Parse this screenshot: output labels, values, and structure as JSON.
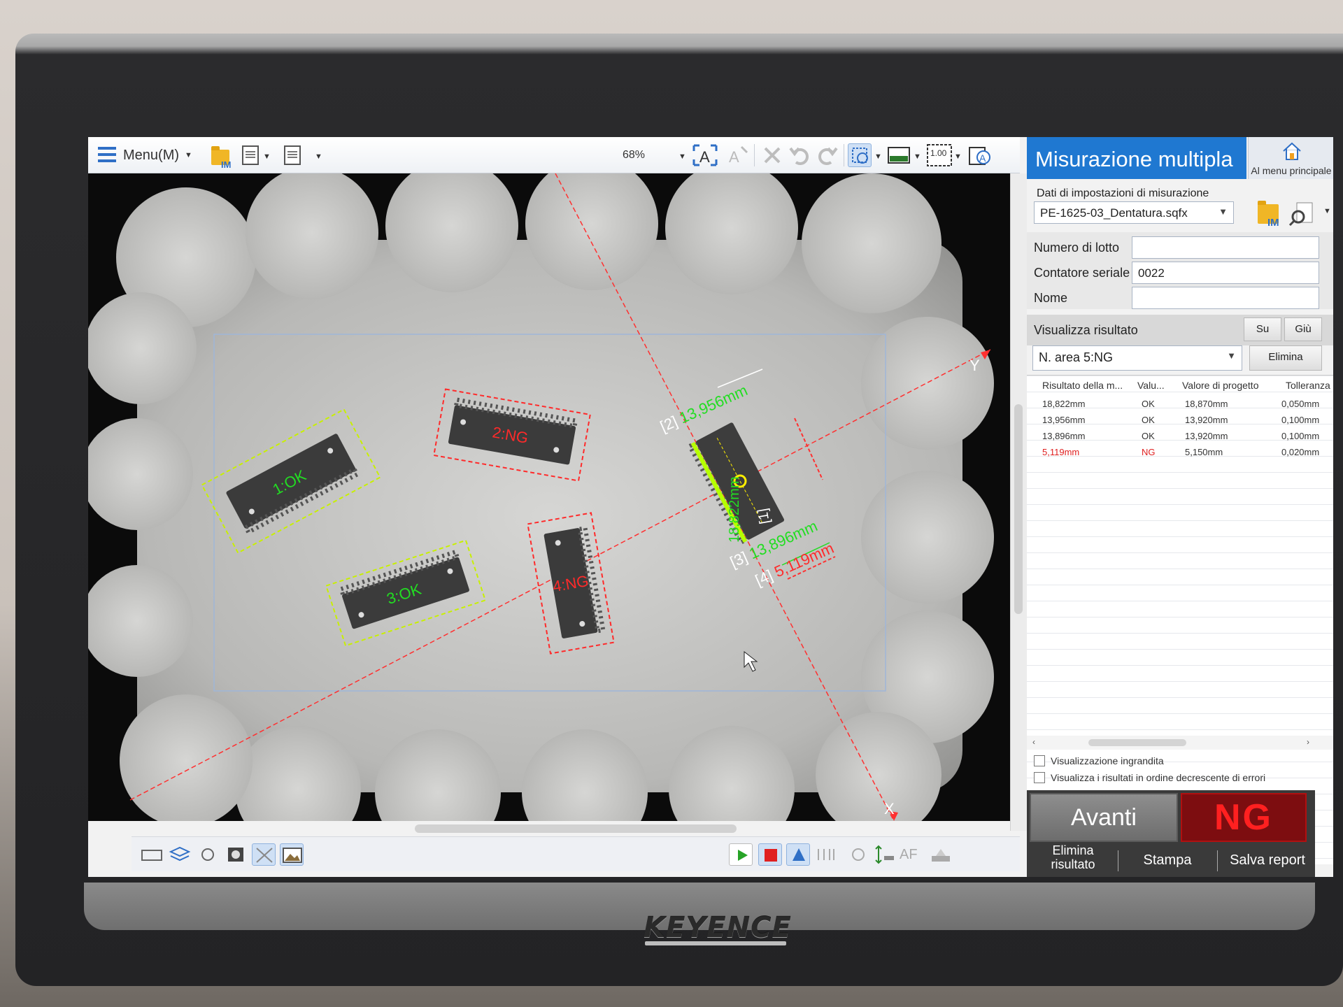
{
  "toolbar": {
    "menu_label": "Menu(M)",
    "zoom_label": "68%",
    "im_tag": "IM",
    "value_tag": "1.00"
  },
  "image": {
    "axis_x_label": "X",
    "axis_y_label": "Y",
    "areas": [
      {
        "label": "1:OK",
        "status": "OK"
      },
      {
        "label": "2:NG",
        "status": "NG"
      },
      {
        "label": "3:OK",
        "status": "OK"
      },
      {
        "label": "4:NG",
        "status": "NG"
      }
    ],
    "measurements": [
      {
        "tag": "[1]",
        "value": "18,822mm",
        "status": "OK"
      },
      {
        "tag": "[2]",
        "value": "13,956mm",
        "status": "OK"
      },
      {
        "tag": "[3]",
        "value": "13,896mm",
        "status": "OK"
      },
      {
        "tag": "[4]",
        "value": "5,119mm",
        "status": "NG"
      }
    ]
  },
  "panel": {
    "title": "Misurazione multipla",
    "home_label": "Al menu principale",
    "settings_label": "Dati di impostazioni di misurazione",
    "settings_file": "PE-1625-03_Dentatura.sqfx",
    "im_tag": "IM",
    "lot_label": "Numero di lotto",
    "lot_value": "",
    "serial_label": "Contatore seriale",
    "serial_value": "0022",
    "name_label": "Nome",
    "name_value": "",
    "result_section": "Visualizza risultato",
    "up_btn": "Su",
    "down_btn": "Giù",
    "area_select": "N. area 5:NG",
    "delete_btn": "Elimina",
    "table": {
      "headers": [
        "Risultato della m...",
        "Valu...",
        "Valore di progetto",
        "Tolleranza"
      ],
      "rows": [
        {
          "result": "18,822mm",
          "judge": "OK",
          "design": "18,870mm",
          "tol": "0,050mm"
        },
        {
          "result": "13,956mm",
          "judge": "OK",
          "design": "13,920mm",
          "tol": "0,100mm"
        },
        {
          "result": "13,896mm",
          "judge": "OK",
          "design": "13,920mm",
          "tol": "0,100mm"
        },
        {
          "result": "5,119mm",
          "judge": "NG",
          "design": "5,150mm",
          "tol": "0,020mm"
        }
      ]
    },
    "check_enlarged": "Visualizzazione ingrandita",
    "check_errors_desc": "Visualizza i risultati in ordine decrescente di errori",
    "next_btn": "Avanti",
    "overall_result": "NG",
    "delete_result_btn_line1": "Elimina",
    "delete_result_btn_line2": "risultato",
    "print_btn": "Stampa",
    "save_report_btn": "Salva report"
  },
  "bezel": {
    "brand": "KEYENCE"
  },
  "colors": {
    "accent": "#1f78d1",
    "ok": "#22dd22",
    "ng": "#ff2a2a",
    "ok_box": "#c8f000"
  }
}
